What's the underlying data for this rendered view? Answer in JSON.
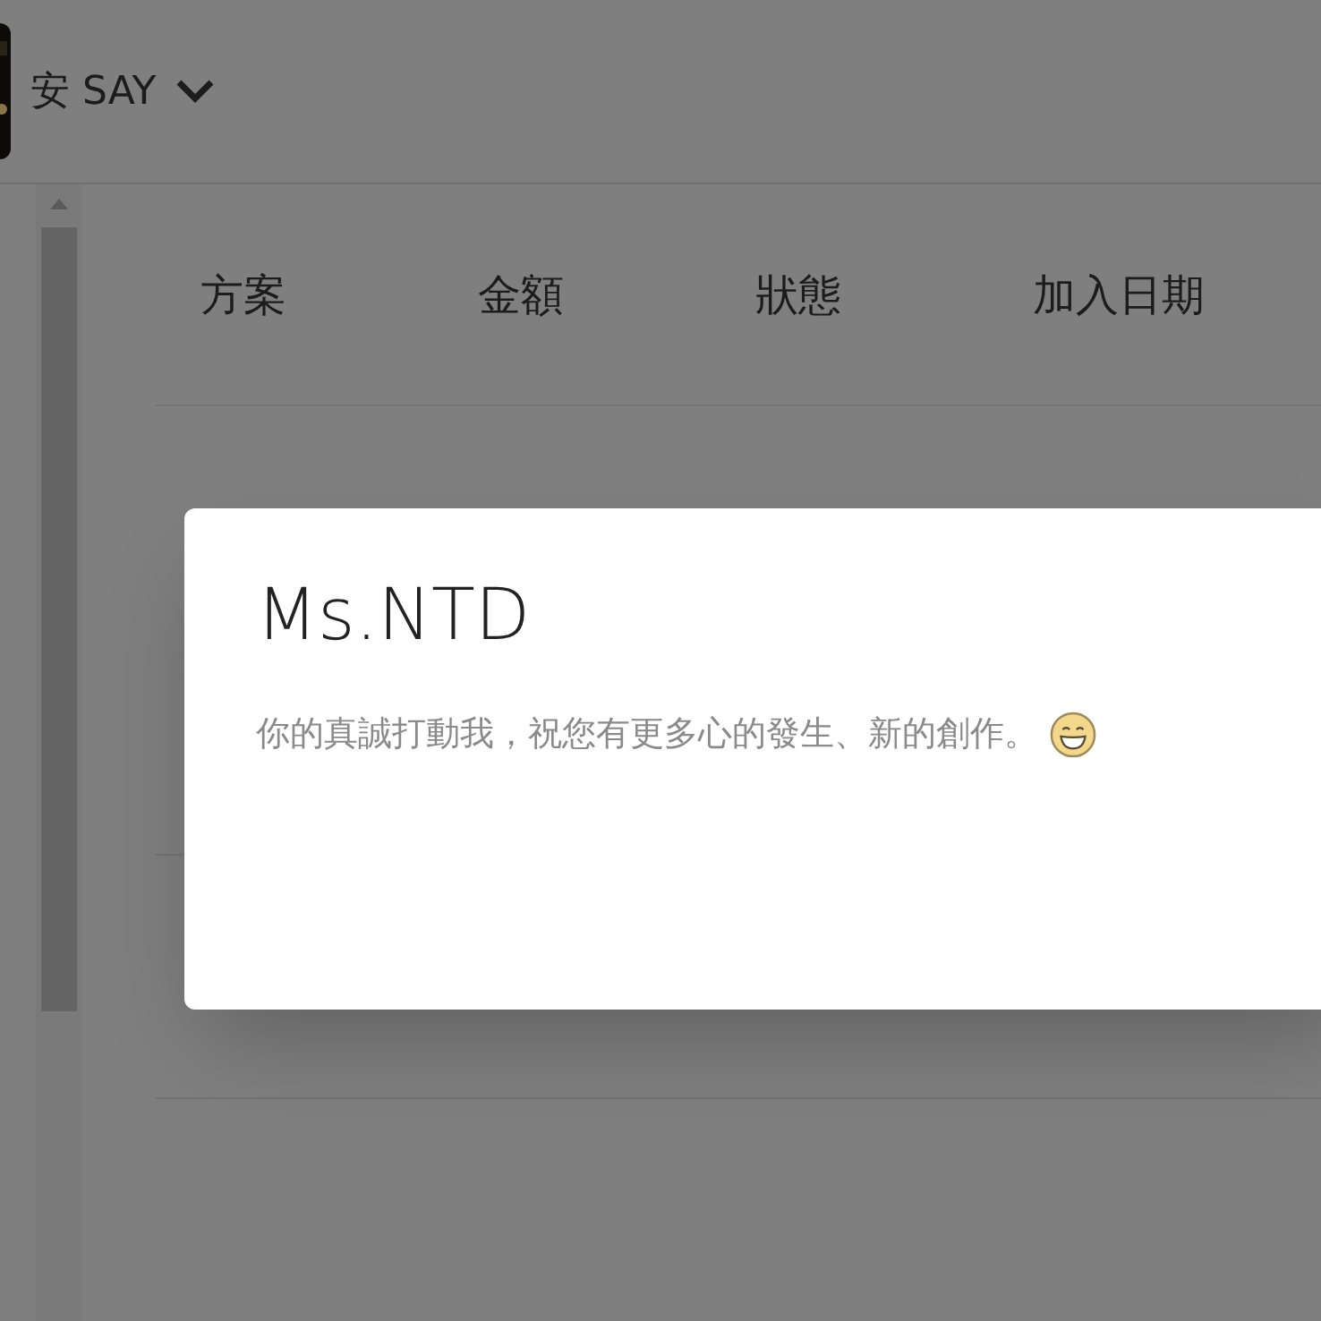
{
  "header": {
    "user_name": "安 SAY"
  },
  "table": {
    "columns": [
      "方案",
      "金額",
      "狀態",
      "加入日期"
    ]
  },
  "dialog": {
    "title": "Ms.NTD",
    "message": "你的真誠打動我，祝您有更多心的發生、新的創作。"
  }
}
